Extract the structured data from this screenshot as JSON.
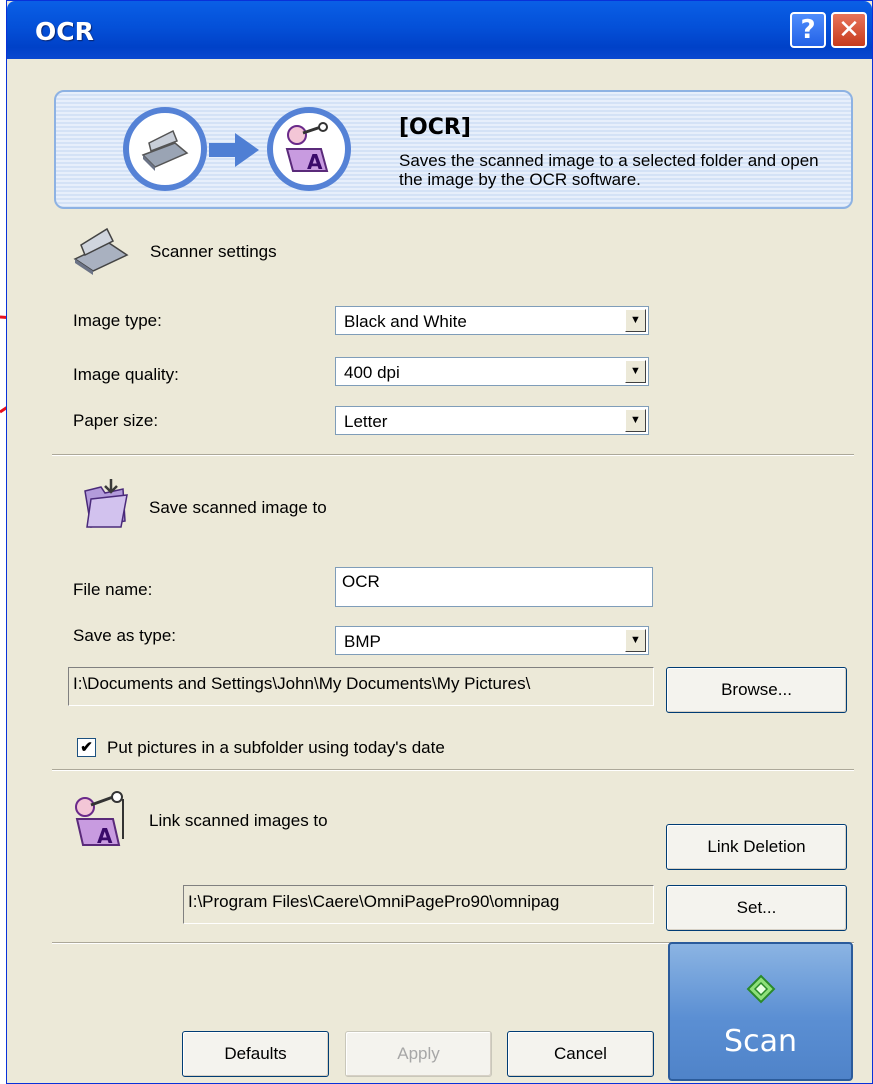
{
  "window": {
    "title": "OCR",
    "help_button": "?",
    "close_button": "✕"
  },
  "banner": {
    "title": "[OCR]",
    "description": "Saves the scanned image to a selected folder and open the image by the OCR software."
  },
  "scanner_settings": {
    "heading": "Scanner settings",
    "image_type_label": "Image type:",
    "image_type_value": "Black and White",
    "image_quality_label": "Image quality:",
    "image_quality_value": "400 dpi",
    "paper_size_label": "Paper size:",
    "paper_size_value": "Letter"
  },
  "save_settings": {
    "heading": "Save scanned image to",
    "file_name_label": "File name:",
    "file_name_value": "OCR",
    "save_as_type_label": "Save as type:",
    "save_as_type_value": "BMP",
    "folder_path": "I:\\Documents and Settings\\John\\My Documents\\My Pictures\\",
    "browse_button": "Browse...",
    "subfolder_checkbox_label": "Put pictures in a subfolder using today's date",
    "subfolder_checked": true
  },
  "link_settings": {
    "heading": "Link scanned images to",
    "link_deletion_button": "Link Deletion",
    "app_path": "I:\\Program Files\\Caere\\OmniPagePro90\\omnipag",
    "set_button": "Set..."
  },
  "footer": {
    "defaults_button": "Defaults",
    "apply_button": "Apply",
    "cancel_button": "Cancel",
    "scan_button": "Scan"
  },
  "colors": {
    "titlebar": "#0450d8",
    "dialog_bg": "#ece9d8",
    "annotation": "#e8101c",
    "scan_button": "#5b8fd3"
  }
}
